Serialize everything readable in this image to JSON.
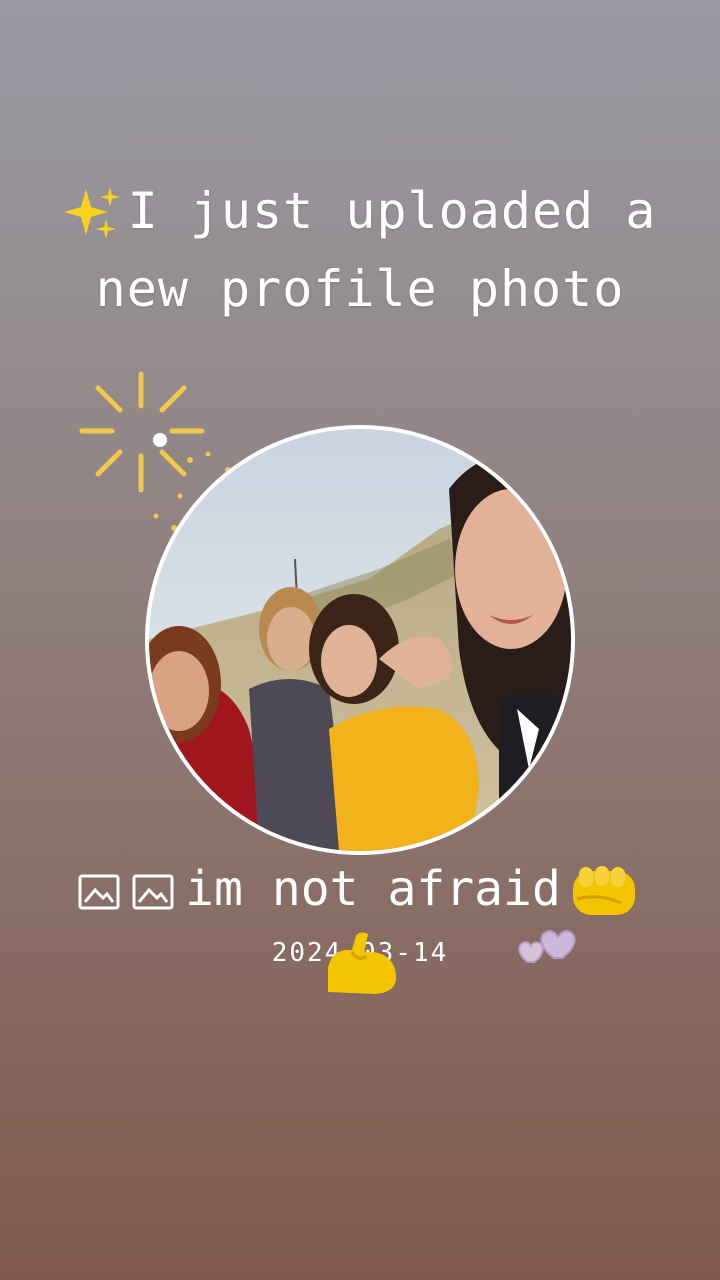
{
  "headline": {
    "line1": "I just uploaded a",
    "line2": "new profile photo",
    "emoji": "sparkles-icon"
  },
  "photo": {
    "alt_name": "group-selfie-photo"
  },
  "caption": {
    "text": "im not afraid",
    "prefix_icons": [
      "photo-icon",
      "photo-icon"
    ],
    "suffix_icon": "oncoming-fist-icon"
  },
  "date": "2024-03-14",
  "decorations": [
    "firework-burst-icon",
    "flexed-biceps-icon",
    "bubble-hearts-icon"
  ],
  "colors": {
    "text": "#ffffff",
    "accent_yellow": "#f5c400",
    "frame": "#ffffff"
  }
}
